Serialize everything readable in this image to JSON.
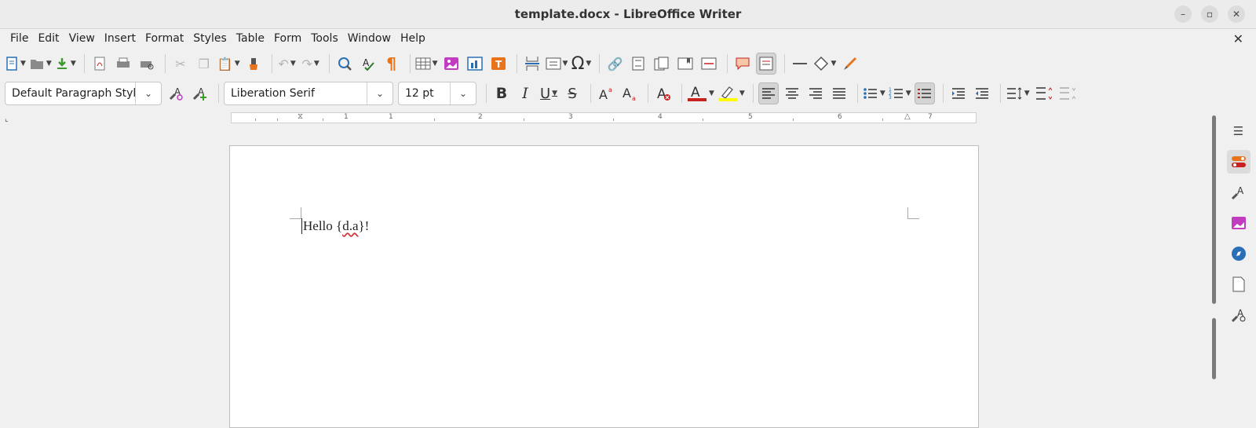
{
  "window": {
    "title": "template.docx - LibreOffice Writer"
  },
  "menubar": {
    "items": [
      "File",
      "Edit",
      "View",
      "Insert",
      "Format",
      "Styles",
      "Table",
      "Form",
      "Tools",
      "Window",
      "Help"
    ]
  },
  "formatting": {
    "paragraph_style": "Default Paragraph Styl",
    "font_name": "Liberation Serif",
    "font_size": "12 pt"
  },
  "document": {
    "text_before": "Hello {",
    "misspelled": "d.a",
    "text_after": "}!"
  },
  "colors": {
    "font_color": "#c9211e",
    "highlight_color": "#ffff00",
    "accent_pilcrow": "#e8731a",
    "spell_check": "#2a7a2a"
  },
  "icons": {
    "toolbar1": [
      "new-icon",
      "open-icon",
      "save-icon",
      "export-pdf-icon",
      "print-icon",
      "print-preview-icon",
      "cut-icon",
      "copy-icon",
      "paste-icon",
      "clone-formatting-icon",
      "undo-icon",
      "redo-icon",
      "find-replace-icon",
      "spelling-icon",
      "formatting-marks-icon",
      "table-icon",
      "image-icon",
      "chart-icon",
      "text-box-icon",
      "page-break-icon",
      "field-icon",
      "special-character-icon",
      "hyperlink-icon",
      "footnote-icon",
      "endnote-icon",
      "bookmark-icon",
      "cross-reference-icon",
      "comment-icon",
      "track-changes-icon",
      "line-icon",
      "shapes-icon",
      "draw-icon"
    ],
    "toolbar2": [
      "update-style-icon",
      "new-style-icon",
      "bold-icon",
      "italic-icon",
      "underline-icon",
      "strikethrough-icon",
      "superscript-icon",
      "subscript-icon",
      "clear-formatting-icon",
      "font-color-icon",
      "highlight-icon",
      "align-left-icon",
      "align-center-icon",
      "align-right-icon",
      "justify-icon",
      "bullets-icon",
      "numbering-icon",
      "outline-icon",
      "increase-indent-icon",
      "decrease-indent-icon",
      "line-spacing-icon",
      "paragraph-spacing-increase-icon",
      "paragraph-spacing-decrease-icon"
    ],
    "sidebar": [
      "sidebar-menu-icon",
      "properties-icon",
      "styles-icon",
      "gallery-icon",
      "navigator-icon",
      "page-icon",
      "style-inspector-icon"
    ]
  }
}
